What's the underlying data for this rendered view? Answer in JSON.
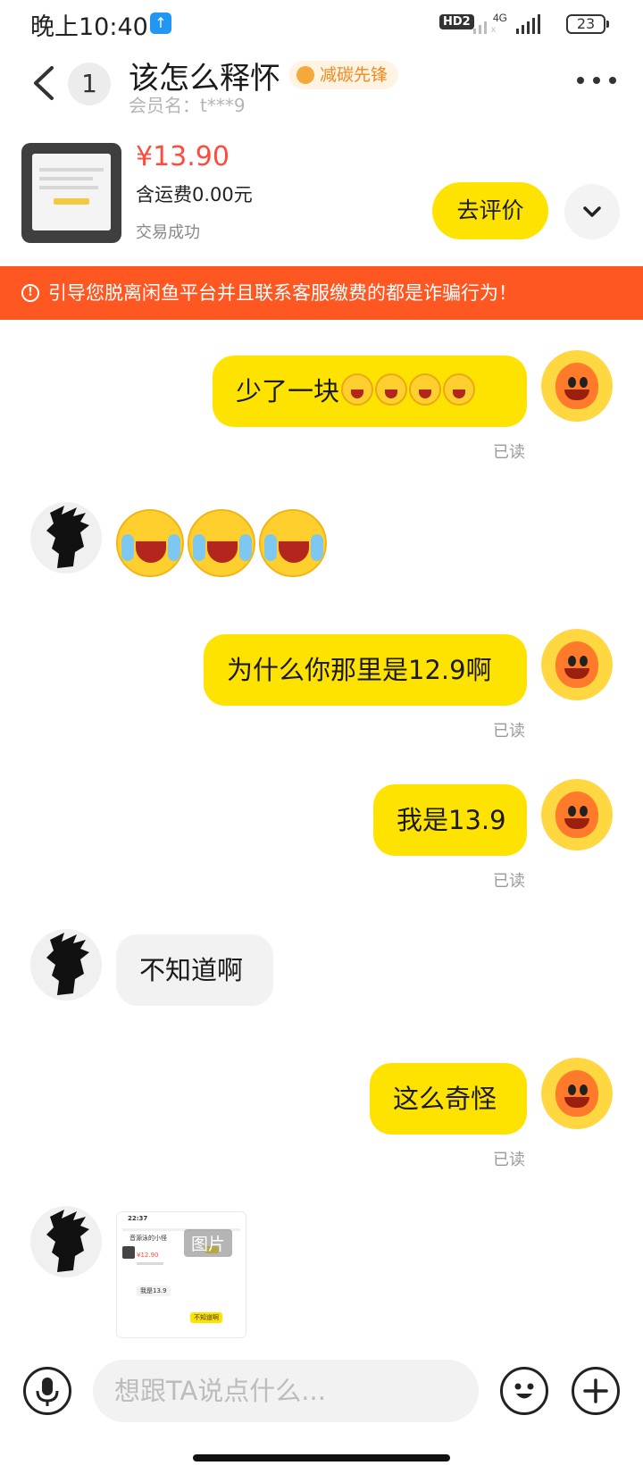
{
  "status_bar": {
    "time": "晚上10:40",
    "upload_icon": "arrow-up-icon",
    "hd_label": "HD2",
    "network_label": "4G",
    "battery": "23"
  },
  "header": {
    "title": "该怎么释怀",
    "tag": "减碳先锋",
    "member": "会员名：t***9",
    "unread_count": "1",
    "icons": {
      "back": "chevron-left-icon",
      "more": "more-dots-icon"
    }
  },
  "product": {
    "price": "¥13.90",
    "shipping": "含运费0.00元",
    "status": "交易成功",
    "review_button": "去评价",
    "expand_icon": "chevron-down-icon"
  },
  "warning": {
    "text": "引导您脱离闲鱼平台并且联系客服缴费的都是诈骗行为！",
    "icon": "alert-circle-icon"
  },
  "messages": [
    {
      "from": "me",
      "text": "少了一块",
      "emoji_count": 4,
      "read": "已读"
    },
    {
      "from": "them",
      "emoji_only": true,
      "emoji_count": 3
    },
    {
      "from": "me",
      "text": "为什么你那里是12.9啊",
      "read": "已读"
    },
    {
      "from": "me",
      "text": "我是13.9",
      "read": "已读"
    },
    {
      "from": "them",
      "text": "不知道啊"
    },
    {
      "from": "me",
      "text": "这么奇怪",
      "read": "已读"
    },
    {
      "from": "them",
      "image": true,
      "label": "图片",
      "thumb": {
        "time": "22:37",
        "title": "音源泳的小怪",
        "price": "¥12.90",
        "chip_me": "我是13.9",
        "chip_them": "不知道啊"
      }
    }
  ],
  "input": {
    "placeholder": "想跟TA说点什么...",
    "icons": {
      "voice": "microphone-icon",
      "emoji": "emoji-face-icon",
      "plus": "plus-icon"
    }
  },
  "colors": {
    "accent_yellow": "#ffe300",
    "price_red": "#ff4a3d",
    "warning_orange": "#ff5722",
    "read_gray": "#9a9a9a"
  }
}
